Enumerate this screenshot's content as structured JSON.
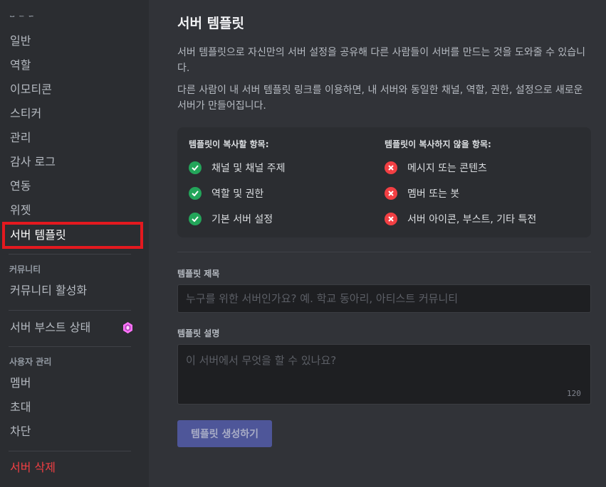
{
  "sidebar": {
    "cut_header": "ᄆᄂᄋᄅ",
    "items": [
      {
        "label": "일반"
      },
      {
        "label": "역할"
      },
      {
        "label": "이모티콘"
      },
      {
        "label": "스티커"
      },
      {
        "label": "관리"
      },
      {
        "label": "감사 로그"
      },
      {
        "label": "연동"
      },
      {
        "label": "위젯"
      },
      {
        "label": "서버 템플릿"
      }
    ],
    "community_header": "커뮤니티",
    "community_item": "커뮤니티 활성화",
    "boost_item": "서버 부스트 상태",
    "user_mgmt_header": "사용자 관리",
    "user_items": [
      {
        "label": "멤버"
      },
      {
        "label": "초대"
      },
      {
        "label": "차단"
      }
    ],
    "delete_item": "서버 삭제"
  },
  "main": {
    "title": "서버 템플릿",
    "desc1": "서버 템플릿으로 자신만의 서버 설정을 공유해 다른 사람들이 서버를 만드는 것을 도와줄 수 있습니다.",
    "desc2": "다른 사람이 내 서버 템플릿 링크를 이용하면, 내 서버와 동일한 채널, 역할, 권한, 설정으로 새로운 서버가 만들어집니다.",
    "copied_title": "템플릿이 복사할 항목:",
    "copied_items": [
      "채널 및 채널 주제",
      "역할 및 권한",
      "기본 서버 설정"
    ],
    "not_copied_title": "템플릿이 복사하지 않을 항목:",
    "not_copied_items": [
      "메시지 또는 콘텐츠",
      "멤버 또는 봇",
      "서버 아이콘, 부스트, 기타 특전"
    ],
    "name_label": "템플릿 제목",
    "name_placeholder": "누구를 위한 서버인가요? 예. 학교 동아리, 아티스트 커뮤니티",
    "desc_label": "템플릿 설명",
    "desc_placeholder": "이 서버에서 무엇을 할 수 있나요?",
    "char_counter": "120",
    "create_button": "템플릿 생성하기"
  },
  "colors": {
    "selected_highlight": "#e4191f",
    "success": "#23a55a",
    "danger": "#f23f43",
    "button": "#4e5699",
    "boost_gem": "#ff73fa"
  }
}
